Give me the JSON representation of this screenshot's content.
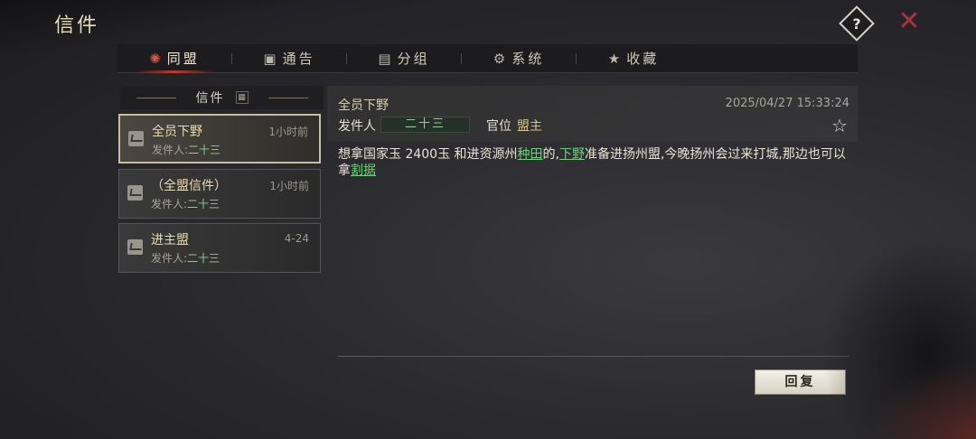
{
  "header": {
    "title": "信件",
    "help_label": "?",
    "close_label": "✕"
  },
  "tabs": [
    {
      "label": "同盟",
      "icon": "alliance-icon",
      "glyph": "✺",
      "active": true
    },
    {
      "label": "通告",
      "icon": "notice-icon",
      "glyph": "▣",
      "active": false
    },
    {
      "label": "分组",
      "icon": "group-icon",
      "glyph": "▤",
      "active": false
    },
    {
      "label": "系统",
      "icon": "gear-icon",
      "glyph": "⚙",
      "active": false
    },
    {
      "label": "收藏",
      "icon": "star-icon",
      "glyph": "★",
      "active": false
    }
  ],
  "mail_list": {
    "header_label": "信件",
    "sort_glyph": "▦",
    "items": [
      {
        "subject": "全员下野",
        "time": "1小时前",
        "from_label": "发件人:",
        "from_name": "二十三",
        "selected": true
      },
      {
        "subject": "（全盟信件）",
        "time": "1小时前",
        "from_label": "发件人:",
        "from_name": "二十三",
        "selected": false
      },
      {
        "subject": "进主盟",
        "time": "4-24",
        "from_label": "发件人:",
        "from_name": "二十三",
        "selected": false
      }
    ]
  },
  "detail": {
    "subject": "全员下野",
    "date": "2025/04/27 15:33:24",
    "from_label": "发件人",
    "from_name": "二十三",
    "rank_label": "官位",
    "rank_value": "盟主",
    "star_glyph": "☆",
    "body": {
      "part1": "想拿国家玉 2400玉 和进资源州",
      "link1": "种田",
      "part2": "的,",
      "link2": "下野",
      "part3": "准备进扬州盟,今晚扬州会过来打城,那边也可以拿",
      "link3": "割据"
    }
  },
  "reply_label": "回复",
  "colors": {
    "accent_red": "#c0392b",
    "link_green": "#6fd07a",
    "name_green": "#8ed08a",
    "rank_gold": "#d8c480"
  }
}
